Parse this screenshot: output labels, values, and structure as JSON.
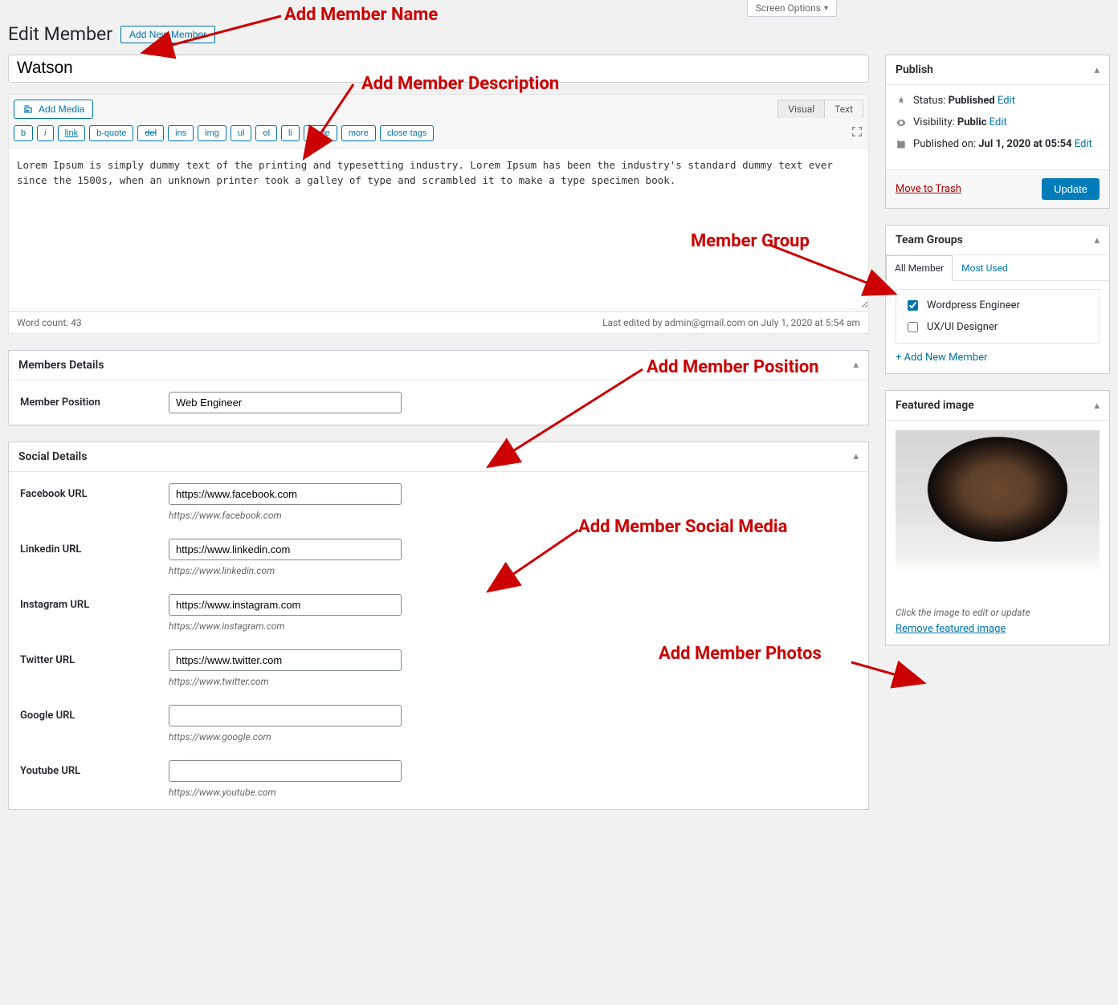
{
  "topbar": {
    "screen_options": "Screen Options"
  },
  "page": {
    "title": "Edit Member",
    "add_new": "Add New Member"
  },
  "member": {
    "name": "Watson"
  },
  "editor": {
    "add_media": "Add Media",
    "tab_visual": "Visual",
    "tab_text": "Text",
    "qt": [
      "b",
      "i",
      "link",
      "b-quote",
      "del",
      "ins",
      "img",
      "ul",
      "ol",
      "li",
      "code",
      "more",
      "close tags"
    ],
    "content": "Lorem Ipsum is simply dummy text of the printing and typesetting industry. Lorem Ipsum has been the industry's standard dummy text ever since the 1500s, when an unknown printer took a galley of type and scrambled it to make a type specimen book.",
    "word_count_label": "Word count: 43",
    "last_edited": "Last edited by admin@gmail.com on July 1, 2020 at 5:54 am"
  },
  "members_details": {
    "heading": "Members Details",
    "position_label": "Member Position",
    "position_value": "Web Engineer"
  },
  "social": {
    "heading": "Social Details",
    "fields": [
      {
        "label": "Facebook URL",
        "value": "https://www.facebook.com",
        "hint": "https://www.facebook.com"
      },
      {
        "label": "Linkedin URL",
        "value": "https://www.linkedin.com",
        "hint": "https://www.linkedin.com"
      },
      {
        "label": "Instagram URL",
        "value": "https://www.instagram.com",
        "hint": "https://www.instagram.com"
      },
      {
        "label": "Twitter URL",
        "value": "https://www.twitter.com",
        "hint": "https://www.twitter.com"
      },
      {
        "label": "Google URL",
        "value": "",
        "hint": "https://www.google.com"
      },
      {
        "label": "Youtube URL",
        "value": "",
        "hint": "https://www.youtube.com"
      }
    ]
  },
  "publish": {
    "heading": "Publish",
    "status_label": "Status:",
    "status_value": "Published",
    "visibility_label": "Visibility:",
    "visibility_value": "Public",
    "published_label": "Published on:",
    "published_value": "Jul 1, 2020 at 05:54",
    "edit": "Edit",
    "trash": "Move to Trash",
    "update": "Update"
  },
  "team_groups": {
    "heading": "Team Groups",
    "tab_all": "All Member",
    "tab_most": "Most Used",
    "items": [
      {
        "label": "Wordpress Engineer",
        "checked": true
      },
      {
        "label": "UX/UI Designer",
        "checked": false
      }
    ],
    "add_new": "+ Add New Member"
  },
  "featured": {
    "heading": "Featured image",
    "note": "Click the image to edit or update",
    "remove": "Remove featured image"
  },
  "annotations": {
    "name": "Add Member Name",
    "description": "Add Member Description",
    "position": "Add Member Position",
    "social": "Add Member Social Media",
    "group": "Member Group",
    "photos": "Add Member Photos"
  }
}
